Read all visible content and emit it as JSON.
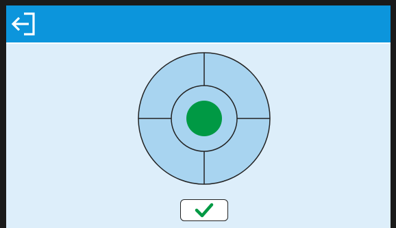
{
  "titlebar": {
    "exit_icon": "exit-arrow-icon",
    "background": "#0c95dc"
  },
  "level_indicator": {
    "bubble_centered": true,
    "bubble_color": "#009944",
    "ring_color": "#a8d4f0"
  },
  "confirm": {
    "icon": "checkmark-icon",
    "icon_color": "#009944"
  }
}
